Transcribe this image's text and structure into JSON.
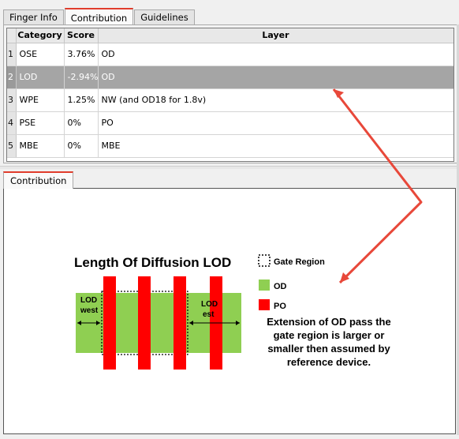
{
  "tabs": [
    "Finger Info",
    "Contribution",
    "Guidelines"
  ],
  "active_tab": 1,
  "table": {
    "columns": [
      "Category",
      "Score",
      "Layer"
    ],
    "rows": [
      {
        "num": "1",
        "category": "OSE",
        "score": "3.76%",
        "layer": "OD"
      },
      {
        "num": "2",
        "category": "LOD",
        "score": "-2.94%",
        "layer": "OD"
      },
      {
        "num": "3",
        "category": "WPE",
        "score": "1.25%",
        "layer": "NW (and OD18 for 1.8v)"
      },
      {
        "num": "4",
        "category": "PSE",
        "score": "0%",
        "layer": "PO"
      },
      {
        "num": "5",
        "category": "MBE",
        "score": "0%",
        "layer": "MBE"
      }
    ],
    "selected_row": 1
  },
  "bottom_tab": "Contribution",
  "diagram": {
    "title": "Length Of Diffusion LOD",
    "legend": {
      "gate": "Gate Region",
      "od": "OD",
      "po": "PO"
    },
    "label_west_1": "LOD",
    "label_west_2": "west",
    "label_est_1": "LOD",
    "label_est_2": "est",
    "description": [
      "Extension of OD pass the",
      "gate region is larger or",
      "smaller then assumed by",
      "reference device."
    ],
    "colors": {
      "od": "#8fcf52",
      "po": "#ff0000",
      "accent_tab": "#e03c2c",
      "arrow": "#e8483a",
      "selection": "#a5a5a5"
    }
  }
}
